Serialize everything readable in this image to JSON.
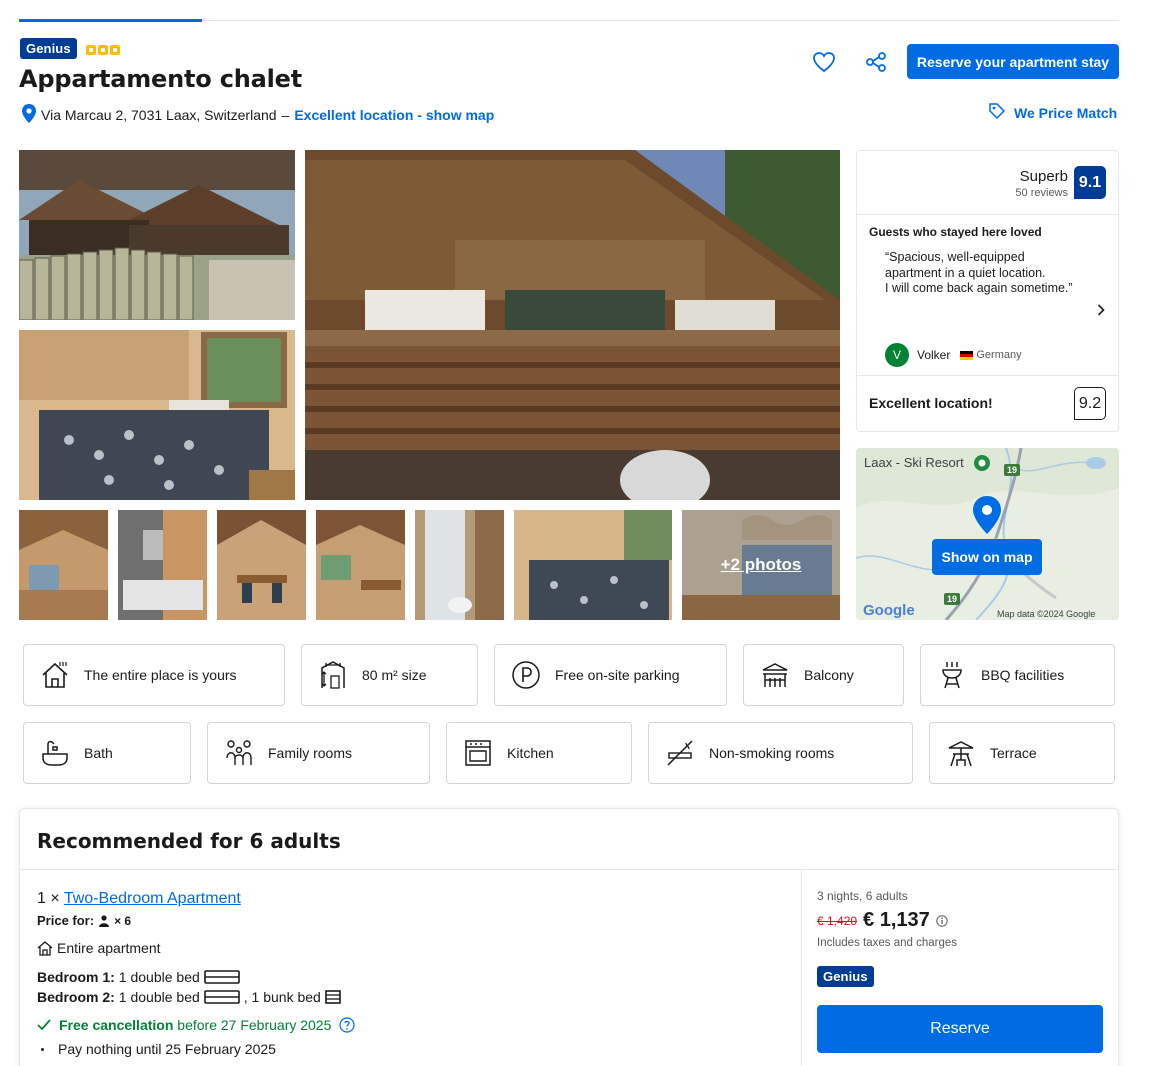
{
  "header": {
    "genius_label": "Genius",
    "title": "Appartamento chalet",
    "address": "Via Marcau 2, 7031 Laax, Switzerland",
    "address_sep": "–",
    "location_link": "Excellent location - show map",
    "reserve_button": "Reserve your apartment stay",
    "price_match": "We Price Match",
    "icons": [
      "heart-icon",
      "share-icon",
      "map-pin-icon",
      "tag-icon"
    ]
  },
  "gallery": {
    "more_photos": "+2 photos"
  },
  "review": {
    "rating_word": "Superb",
    "review_count": "50 reviews",
    "score": "9.1",
    "loved_heading": "Guests who stayed here loved",
    "quote_line1": "“Spacious, well-equipped",
    "quote_line2": "apartment in a quiet location.",
    "quote_line3": "I will come back again sometime.”",
    "reviewer_initial": "V",
    "reviewer_name": "Volker",
    "reviewer_country": "Germany",
    "location_label": "Excellent location!",
    "location_score": "9.2"
  },
  "map": {
    "place_label": "Laax - Ski Resort",
    "road_1": "19",
    "road_2": "19",
    "button": "Show on map",
    "logo": "Google",
    "attribution": "Map data ©2024 Google"
  },
  "facilities": [
    {
      "label": "The entire place is yours",
      "icon": "house-icon"
    },
    {
      "label": "80 m² size",
      "icon": "size-icon"
    },
    {
      "label": "Free on-site parking",
      "icon": "parking-icon"
    },
    {
      "label": "Balcony",
      "icon": "balcony-icon"
    },
    {
      "label": "BBQ facilities",
      "icon": "bbq-icon"
    },
    {
      "label": "Bath",
      "icon": "bath-icon"
    },
    {
      "label": "Family rooms",
      "icon": "family-icon"
    },
    {
      "label": "Kitchen",
      "icon": "kitchen-icon"
    },
    {
      "label": "Non-smoking rooms",
      "icon": "no-smoking-icon"
    },
    {
      "label": "Terrace",
      "icon": "terrace-icon"
    }
  ],
  "recommendation": {
    "heading": "Recommended for 6 adults",
    "room_qty": "1 ×",
    "room_name": "Two-Bedroom Apartment",
    "price_for_label": "Price for:",
    "price_for_count": "× 6",
    "entire_apartment": "Entire apartment",
    "bedroom1_label": "Bedroom 1:",
    "bedroom1_value": "1 double bed",
    "bedroom2_label": "Bedroom 2:",
    "bedroom2_value": "1 double bed",
    "bedroom2_extra": ", 1 bunk bed",
    "free_cancel": "Free cancellation",
    "free_cancel_date": "before 27 February 2025",
    "pay_nothing": "Pay nothing until 25 February 2025",
    "stay_summary": "3 nights, 6 adults",
    "old_price": "€ 1,420",
    "price": "€ 1,137",
    "taxes": "Includes taxes and charges",
    "genius_label": "Genius",
    "reserve_button": "Reserve"
  },
  "colors": {
    "accent": "#006ce4",
    "brand_dark": "#003b95",
    "genius_yellow": "#febb02",
    "green": "#008234",
    "old_price_red": "#d4111e"
  }
}
